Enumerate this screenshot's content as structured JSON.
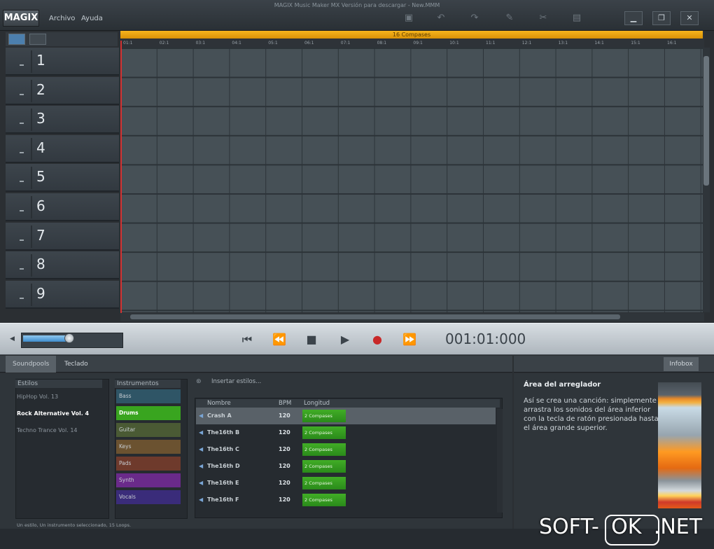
{
  "window": {
    "title": "MAGIX Music Maker MX Versión para descargar  -  New.MMM",
    "logo": "MAGIX",
    "menu": [
      "Archivo",
      "Ayuda"
    ],
    "toolbar_icons": [
      "save-icon",
      "undo-icon",
      "redo-icon",
      "pencil-icon",
      "cut-icon",
      "delete-icon"
    ],
    "window_buttons": [
      "minimize-icon",
      "restore-icon",
      "close-icon"
    ]
  },
  "arranger": {
    "loop_label": "16 Compases",
    "ruler_ticks": [
      "01:1",
      "02:1",
      "03:1",
      "04:1",
      "05:1",
      "06:1",
      "07:1",
      "08:1",
      "09:1",
      "10:1",
      "11:1",
      "12:1",
      "13:1",
      "14:1",
      "15:1",
      "16:1"
    ],
    "tracks": [
      "1",
      "2",
      "3",
      "4",
      "5",
      "6",
      "7",
      "8",
      "9"
    ]
  },
  "transport": {
    "timecode": "001:01:000",
    "volume_fraction": 0.47
  },
  "tabs": {
    "soundpools": "Soundpools",
    "teclado": "Teclado",
    "infobox": "Infobox"
  },
  "soundpool": {
    "estilos_header": "Estilos",
    "estilos": [
      "HipHop Vol. 13",
      "Rock Alternative Vol. 4",
      "Techno Trance Vol. 14"
    ],
    "selected_estilo": 1,
    "instrumentos_header": "Instrumentos",
    "instrumentos": [
      {
        "label": "Bass",
        "color": "#2f5566"
      },
      {
        "label": "Drums",
        "color": "#39a51f"
      },
      {
        "label": "Guitar",
        "color": "#4a5a34"
      },
      {
        "label": "Keys",
        "color": "#6b5230"
      },
      {
        "label": "Pads",
        "color": "#6e3a2c"
      },
      {
        "label": "Synth",
        "color": "#6a2a8a"
      },
      {
        "label": "Vocals",
        "color": "#3a2c7a"
      }
    ],
    "insert_styles": "Insertar estilos...",
    "loop_headers": {
      "name": "Nombre",
      "bpm": "BPM",
      "length": "Longitud"
    },
    "loops": [
      {
        "name": "Crash A",
        "bpm": "120",
        "length": "2 Compases"
      },
      {
        "name": "The16th B",
        "bpm": "120",
        "length": "2 Compases"
      },
      {
        "name": "The16th C",
        "bpm": "120",
        "length": "2 Compases"
      },
      {
        "name": "The16th D",
        "bpm": "120",
        "length": "2 Compases"
      },
      {
        "name": "The16th E",
        "bpm": "120",
        "length": "2 Compases"
      },
      {
        "name": "The16th F",
        "bpm": "120",
        "length": "2 Compases"
      }
    ],
    "status": "Un estilo, Un instrumento seleccionado, 15 Loops."
  },
  "infobox": {
    "title": "Área del arreglador",
    "text": "Así se crea una canción: simplemente arrastra los sonidos del área inferior con la tecla de ratón presionada hasta el área grande superior."
  },
  "watermark": {
    "left": "SOFT-",
    "box": "OK",
    "right": ".NET"
  }
}
